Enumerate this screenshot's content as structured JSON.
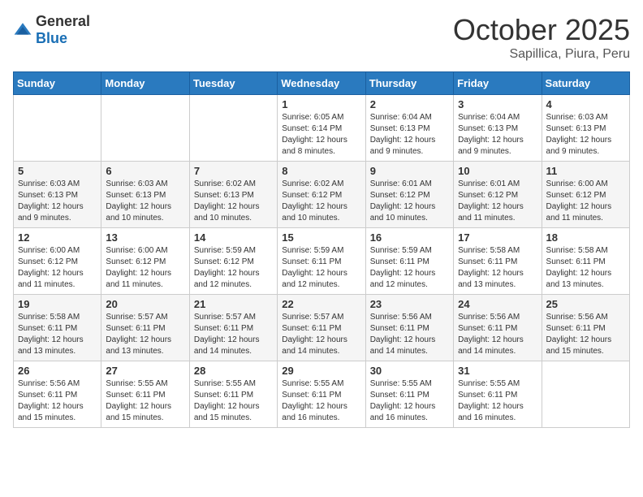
{
  "logo": {
    "general": "General",
    "blue": "Blue"
  },
  "header": {
    "month": "October 2025",
    "location": "Sapillica, Piura, Peru"
  },
  "weekdays": [
    "Sunday",
    "Monday",
    "Tuesday",
    "Wednesday",
    "Thursday",
    "Friday",
    "Saturday"
  ],
  "weeks": [
    [
      {
        "day": "",
        "sunrise": "",
        "sunset": "",
        "daylight": ""
      },
      {
        "day": "",
        "sunrise": "",
        "sunset": "",
        "daylight": ""
      },
      {
        "day": "",
        "sunrise": "",
        "sunset": "",
        "daylight": ""
      },
      {
        "day": "1",
        "sunrise": "Sunrise: 6:05 AM",
        "sunset": "Sunset: 6:14 PM",
        "daylight": "Daylight: 12 hours and 8 minutes."
      },
      {
        "day": "2",
        "sunrise": "Sunrise: 6:04 AM",
        "sunset": "Sunset: 6:13 PM",
        "daylight": "Daylight: 12 hours and 9 minutes."
      },
      {
        "day": "3",
        "sunrise": "Sunrise: 6:04 AM",
        "sunset": "Sunset: 6:13 PM",
        "daylight": "Daylight: 12 hours and 9 minutes."
      },
      {
        "day": "4",
        "sunrise": "Sunrise: 6:03 AM",
        "sunset": "Sunset: 6:13 PM",
        "daylight": "Daylight: 12 hours and 9 minutes."
      }
    ],
    [
      {
        "day": "5",
        "sunrise": "Sunrise: 6:03 AM",
        "sunset": "Sunset: 6:13 PM",
        "daylight": "Daylight: 12 hours and 9 minutes."
      },
      {
        "day": "6",
        "sunrise": "Sunrise: 6:03 AM",
        "sunset": "Sunset: 6:13 PM",
        "daylight": "Daylight: 12 hours and 10 minutes."
      },
      {
        "day": "7",
        "sunrise": "Sunrise: 6:02 AM",
        "sunset": "Sunset: 6:13 PM",
        "daylight": "Daylight: 12 hours and 10 minutes."
      },
      {
        "day": "8",
        "sunrise": "Sunrise: 6:02 AM",
        "sunset": "Sunset: 6:12 PM",
        "daylight": "Daylight: 12 hours and 10 minutes."
      },
      {
        "day": "9",
        "sunrise": "Sunrise: 6:01 AM",
        "sunset": "Sunset: 6:12 PM",
        "daylight": "Daylight: 12 hours and 10 minutes."
      },
      {
        "day": "10",
        "sunrise": "Sunrise: 6:01 AM",
        "sunset": "Sunset: 6:12 PM",
        "daylight": "Daylight: 12 hours and 11 minutes."
      },
      {
        "day": "11",
        "sunrise": "Sunrise: 6:00 AM",
        "sunset": "Sunset: 6:12 PM",
        "daylight": "Daylight: 12 hours and 11 minutes."
      }
    ],
    [
      {
        "day": "12",
        "sunrise": "Sunrise: 6:00 AM",
        "sunset": "Sunset: 6:12 PM",
        "daylight": "Daylight: 12 hours and 11 minutes."
      },
      {
        "day": "13",
        "sunrise": "Sunrise: 6:00 AM",
        "sunset": "Sunset: 6:12 PM",
        "daylight": "Daylight: 12 hours and 11 minutes."
      },
      {
        "day": "14",
        "sunrise": "Sunrise: 5:59 AM",
        "sunset": "Sunset: 6:12 PM",
        "daylight": "Daylight: 12 hours and 12 minutes."
      },
      {
        "day": "15",
        "sunrise": "Sunrise: 5:59 AM",
        "sunset": "Sunset: 6:11 PM",
        "daylight": "Daylight: 12 hours and 12 minutes."
      },
      {
        "day": "16",
        "sunrise": "Sunrise: 5:59 AM",
        "sunset": "Sunset: 6:11 PM",
        "daylight": "Daylight: 12 hours and 12 minutes."
      },
      {
        "day": "17",
        "sunrise": "Sunrise: 5:58 AM",
        "sunset": "Sunset: 6:11 PM",
        "daylight": "Daylight: 12 hours and 13 minutes."
      },
      {
        "day": "18",
        "sunrise": "Sunrise: 5:58 AM",
        "sunset": "Sunset: 6:11 PM",
        "daylight": "Daylight: 12 hours and 13 minutes."
      }
    ],
    [
      {
        "day": "19",
        "sunrise": "Sunrise: 5:58 AM",
        "sunset": "Sunset: 6:11 PM",
        "daylight": "Daylight: 12 hours and 13 minutes."
      },
      {
        "day": "20",
        "sunrise": "Sunrise: 5:57 AM",
        "sunset": "Sunset: 6:11 PM",
        "daylight": "Daylight: 12 hours and 13 minutes."
      },
      {
        "day": "21",
        "sunrise": "Sunrise: 5:57 AM",
        "sunset": "Sunset: 6:11 PM",
        "daylight": "Daylight: 12 hours and 14 minutes."
      },
      {
        "day": "22",
        "sunrise": "Sunrise: 5:57 AM",
        "sunset": "Sunset: 6:11 PM",
        "daylight": "Daylight: 12 hours and 14 minutes."
      },
      {
        "day": "23",
        "sunrise": "Sunrise: 5:56 AM",
        "sunset": "Sunset: 6:11 PM",
        "daylight": "Daylight: 12 hours and 14 minutes."
      },
      {
        "day": "24",
        "sunrise": "Sunrise: 5:56 AM",
        "sunset": "Sunset: 6:11 PM",
        "daylight": "Daylight: 12 hours and 14 minutes."
      },
      {
        "day": "25",
        "sunrise": "Sunrise: 5:56 AM",
        "sunset": "Sunset: 6:11 PM",
        "daylight": "Daylight: 12 hours and 15 minutes."
      }
    ],
    [
      {
        "day": "26",
        "sunrise": "Sunrise: 5:56 AM",
        "sunset": "Sunset: 6:11 PM",
        "daylight": "Daylight: 12 hours and 15 minutes."
      },
      {
        "day": "27",
        "sunrise": "Sunrise: 5:55 AM",
        "sunset": "Sunset: 6:11 PM",
        "daylight": "Daylight: 12 hours and 15 minutes."
      },
      {
        "day": "28",
        "sunrise": "Sunrise: 5:55 AM",
        "sunset": "Sunset: 6:11 PM",
        "daylight": "Daylight: 12 hours and 15 minutes."
      },
      {
        "day": "29",
        "sunrise": "Sunrise: 5:55 AM",
        "sunset": "Sunset: 6:11 PM",
        "daylight": "Daylight: 12 hours and 16 minutes."
      },
      {
        "day": "30",
        "sunrise": "Sunrise: 5:55 AM",
        "sunset": "Sunset: 6:11 PM",
        "daylight": "Daylight: 12 hours and 16 minutes."
      },
      {
        "day": "31",
        "sunrise": "Sunrise: 5:55 AM",
        "sunset": "Sunset: 6:11 PM",
        "daylight": "Daylight: 12 hours and 16 minutes."
      },
      {
        "day": "",
        "sunrise": "",
        "sunset": "",
        "daylight": ""
      }
    ]
  ]
}
